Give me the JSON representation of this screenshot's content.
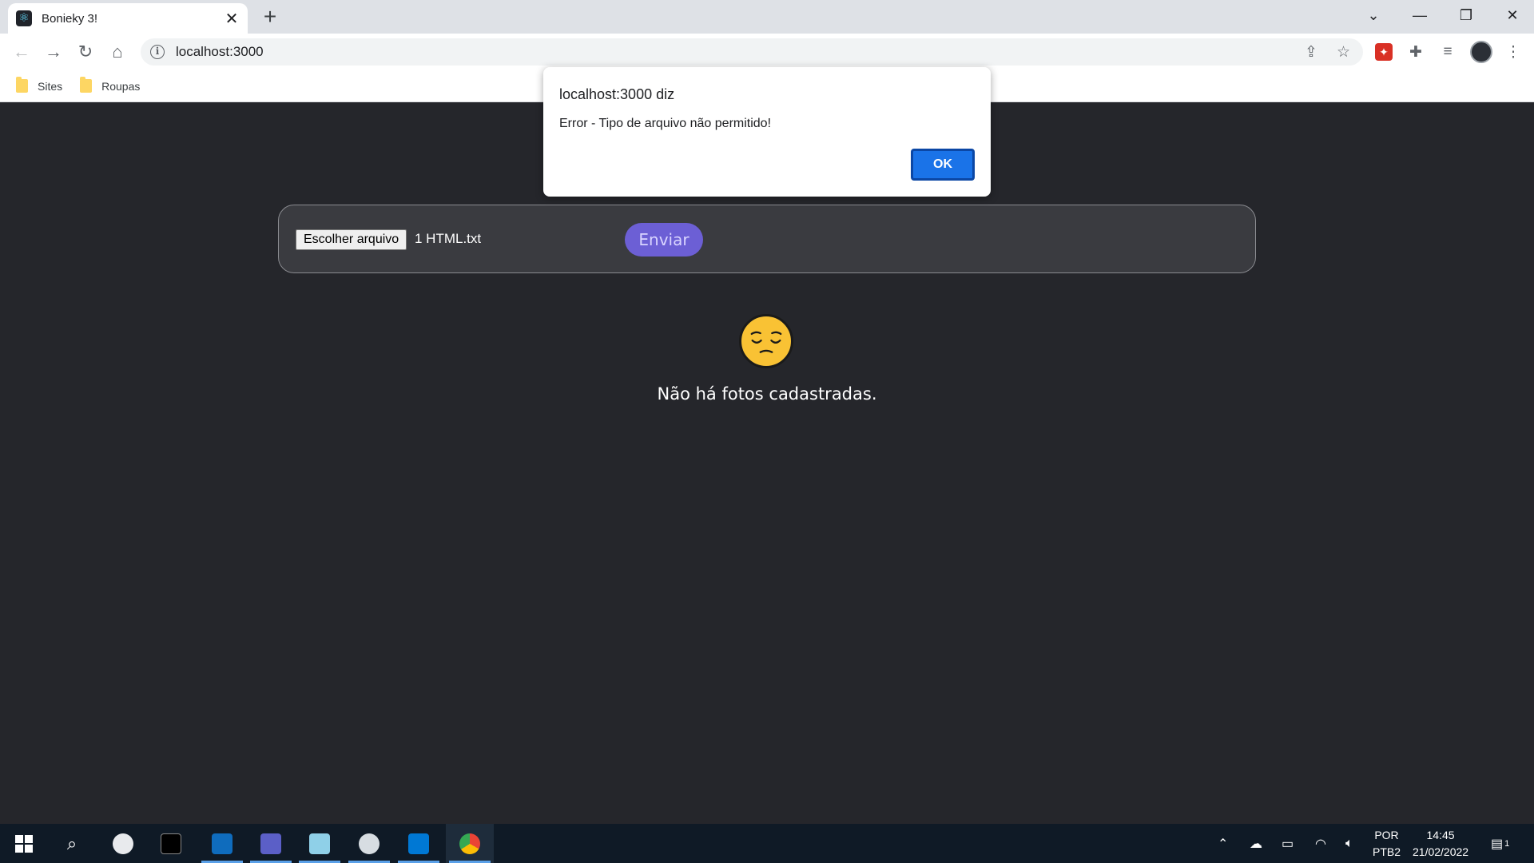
{
  "browser": {
    "tab_title": "Bonieky 3!",
    "tab_close": "✕",
    "new_tab": "+",
    "url": "localhost:3000",
    "window_controls": {
      "collapse": "⌄",
      "minimize": "—",
      "restore": "❐",
      "close": "✕"
    },
    "bookmarks": [
      {
        "label": "Sites"
      },
      {
        "label": "Roupas"
      }
    ]
  },
  "upload_form": {
    "file_button": "Escolher arquivo",
    "file_name": "1 HTML.txt",
    "submit": "Enviar"
  },
  "empty_state": {
    "message": "Não há fotos cadastradas."
  },
  "dialog": {
    "title": "localhost:3000 diz",
    "message": "Error - Tipo de arquivo não permitido!",
    "ok": "OK"
  },
  "taskbar": {
    "language": "POR",
    "layout": "PTB2",
    "time": "14:45",
    "date": "21/02/2022",
    "notification_count": "1"
  },
  "colors": {
    "page_bg": "#25262b",
    "submit_bg": "#6c5fd5",
    "dialog_ok": "#1a73e8",
    "taskbar_bg": "#0f1a26"
  }
}
